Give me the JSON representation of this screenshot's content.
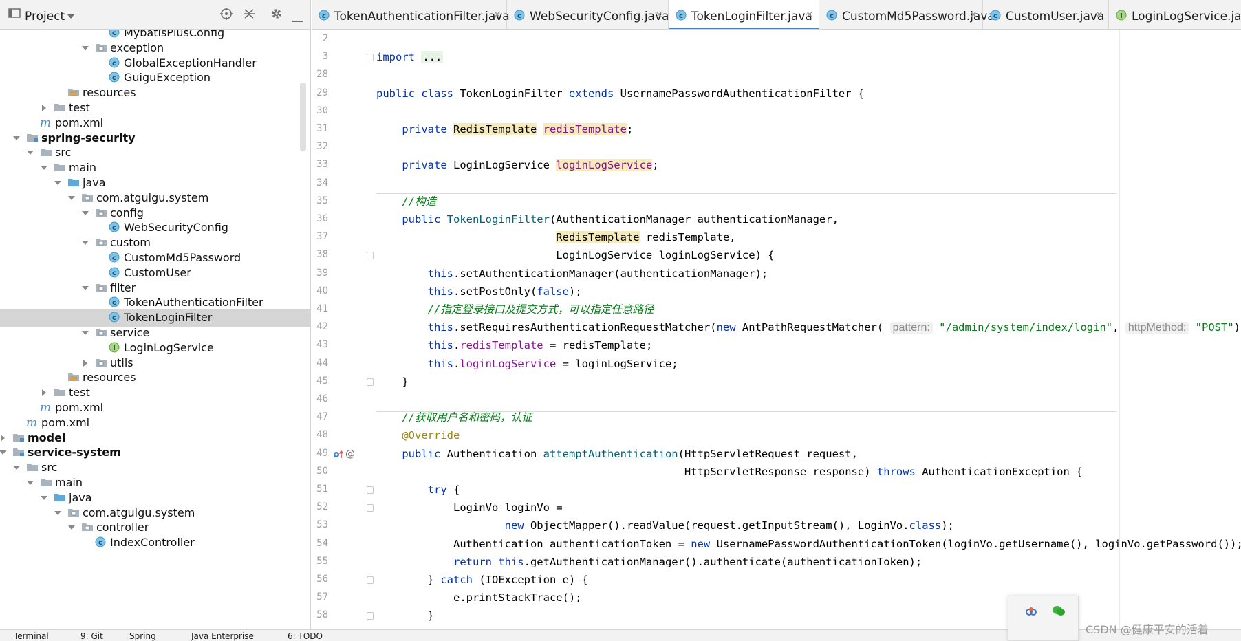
{
  "project": {
    "title": "Project",
    "tree": [
      {
        "label": "MybatisPlusConfig",
        "indent": 9,
        "kind": "class",
        "twisty": "none"
      },
      {
        "label": "exception",
        "indent": 8,
        "kind": "package",
        "twisty": "open"
      },
      {
        "label": "GlobalExceptionHandler",
        "indent": 9,
        "kind": "class",
        "twisty": "none"
      },
      {
        "label": "GuiguException",
        "indent": 9,
        "kind": "class",
        "twisty": "none"
      },
      {
        "label": "resources",
        "indent": 6,
        "kind": "resources",
        "twisty": "none"
      },
      {
        "label": "test",
        "indent": 5,
        "kind": "folder",
        "twisty": "closed"
      },
      {
        "label": "pom.xml",
        "indent": 4,
        "kind": "maven",
        "twisty": "none"
      },
      {
        "label": "spring-security",
        "indent": 3,
        "kind": "module",
        "twisty": "open",
        "bold": true
      },
      {
        "label": "src",
        "indent": 4,
        "kind": "folder",
        "twisty": "open"
      },
      {
        "label": "main",
        "indent": 5,
        "kind": "folder",
        "twisty": "open"
      },
      {
        "label": "java",
        "indent": 6,
        "kind": "source",
        "twisty": "open"
      },
      {
        "label": "com.atguigu.system",
        "indent": 7,
        "kind": "package",
        "twisty": "open"
      },
      {
        "label": "config",
        "indent": 8,
        "kind": "package",
        "twisty": "open"
      },
      {
        "label": "WebSecurityConfig",
        "indent": 9,
        "kind": "class",
        "twisty": "none"
      },
      {
        "label": "custom",
        "indent": 8,
        "kind": "package",
        "twisty": "open"
      },
      {
        "label": "CustomMd5Password",
        "indent": 9,
        "kind": "class",
        "twisty": "none"
      },
      {
        "label": "CustomUser",
        "indent": 9,
        "kind": "class",
        "twisty": "none"
      },
      {
        "label": "filter",
        "indent": 8,
        "kind": "package",
        "twisty": "open"
      },
      {
        "label": "TokenAuthenticationFilter",
        "indent": 9,
        "kind": "class",
        "twisty": "none"
      },
      {
        "label": "TokenLoginFilter",
        "indent": 9,
        "kind": "class",
        "twisty": "none",
        "selected": true
      },
      {
        "label": "service",
        "indent": 8,
        "kind": "package",
        "twisty": "open"
      },
      {
        "label": "LoginLogService",
        "indent": 9,
        "kind": "interface",
        "twisty": "none"
      },
      {
        "label": "utils",
        "indent": 8,
        "kind": "package",
        "twisty": "closed"
      },
      {
        "label": "resources",
        "indent": 6,
        "kind": "resources",
        "twisty": "none"
      },
      {
        "label": "test",
        "indent": 5,
        "kind": "folder",
        "twisty": "closed"
      },
      {
        "label": "pom.xml",
        "indent": 4,
        "kind": "maven",
        "twisty": "none"
      },
      {
        "label": "pom.xml",
        "indent": 3,
        "kind": "maven",
        "twisty": "none"
      },
      {
        "label": "model",
        "indent": 2,
        "kind": "module",
        "twisty": "closed",
        "bold": true
      },
      {
        "label": "service-system",
        "indent": 2,
        "kind": "module",
        "twisty": "open",
        "bold": true
      },
      {
        "label": "src",
        "indent": 3,
        "kind": "folder",
        "twisty": "open"
      },
      {
        "label": "main",
        "indent": 4,
        "kind": "folder",
        "twisty": "open"
      },
      {
        "label": "java",
        "indent": 5,
        "kind": "source",
        "twisty": "open"
      },
      {
        "label": "com.atguigu.system",
        "indent": 6,
        "kind": "package",
        "twisty": "open"
      },
      {
        "label": "controller",
        "indent": 7,
        "kind": "package",
        "twisty": "open"
      },
      {
        "label": "IndexController",
        "indent": 8,
        "kind": "class",
        "twisty": "none"
      }
    ]
  },
  "tabs": [
    {
      "label": "TokenAuthenticationFilter.java",
      "icon": "class-icon",
      "active": false
    },
    {
      "label": "WebSecurityConfig.java",
      "icon": "class-icon",
      "active": false
    },
    {
      "label": "TokenLoginFilter.java",
      "icon": "class-icon",
      "active": true
    },
    {
      "label": "CustomMd5Password.java",
      "icon": "class-icon",
      "active": false
    },
    {
      "label": "CustomUser.java",
      "icon": "class-icon",
      "active": false
    },
    {
      "label": "LoginLogService.java",
      "icon": "interface-icon",
      "active": false
    }
  ],
  "editor": {
    "line_numbers": [
      "2",
      "3",
      "28",
      "29",
      "30",
      "31",
      "32",
      "33",
      "34",
      "35",
      "36",
      "37",
      "38",
      "39",
      "40",
      "41",
      "42",
      "43",
      "44",
      "45",
      "46",
      "47",
      "48",
      "49",
      "50",
      "51",
      "52",
      "53",
      "54",
      "55",
      "56",
      "57",
      "58"
    ],
    "code": [
      [],
      [
        {
          "t": "import ",
          "c": "kw"
        },
        {
          "t": "...",
          "c": "fold-box"
        }
      ],
      [],
      [
        {
          "t": "public class ",
          "c": "kw"
        },
        {
          "t": "TokenLoginFilter "
        },
        {
          "t": "extends ",
          "c": "kw"
        },
        {
          "t": "UsernamePasswordAuthenticationFilter {"
        }
      ],
      [],
      [
        {
          "t": "    private ",
          "c": "kw"
        },
        {
          "t": "RedisTemplate",
          "c": "cls-hl"
        },
        {
          "t": " "
        },
        {
          "t": "redisTemplate",
          "c": "fld cls-hl"
        },
        {
          "t": ";"
        }
      ],
      [],
      [
        {
          "t": "    private ",
          "c": "kw"
        },
        {
          "t": "LoginLogService "
        },
        {
          "t": "loginLogService",
          "c": "fld cls-hl"
        },
        {
          "t": ";"
        }
      ],
      [],
      [
        {
          "t": "    //构造",
          "c": "cmg"
        }
      ],
      [
        {
          "t": "    public ",
          "c": "kw"
        },
        {
          "t": "TokenLoginFilter",
          "c": "def"
        },
        {
          "t": "(AuthenticationManager authenticationManager,"
        }
      ],
      [
        {
          "t": "                            "
        },
        {
          "t": "RedisTemplate",
          "c": "cls-hl"
        },
        {
          "t": " redisTemplate,"
        }
      ],
      [
        {
          "t": "                            LoginLogService loginLogService) {"
        }
      ],
      [
        {
          "t": "        this",
          "c": "kw"
        },
        {
          "t": ".setAuthenticationManager(authenticationManager);"
        }
      ],
      [
        {
          "t": "        this",
          "c": "kw"
        },
        {
          "t": ".setPostOnly("
        },
        {
          "t": "false",
          "c": "kw"
        },
        {
          "t": ");"
        }
      ],
      [
        {
          "t": "        //指定登录接口及提交方式，可以指定任意路径",
          "c": "cmg"
        }
      ],
      [
        {
          "t": "        this",
          "c": "kw"
        },
        {
          "t": ".setRequiresAuthenticationRequestMatcher("
        },
        {
          "t": "new ",
          "c": "kw"
        },
        {
          "t": "AntPathRequestMatcher( "
        },
        {
          "t": "pattern:",
          "c": "hint"
        },
        {
          "t": " "
        },
        {
          "t": "\"/admin/system/index/login\"",
          "c": "str"
        },
        {
          "t": ", "
        },
        {
          "t": "httpMethod:",
          "c": "hint"
        },
        {
          "t": " "
        },
        {
          "t": "\"POST\"",
          "c": "str"
        },
        {
          "t": "));"
        }
      ],
      [
        {
          "t": "        this",
          "c": "kw"
        },
        {
          "t": "."
        },
        {
          "t": "redisTemplate",
          "c": "fld"
        },
        {
          "t": " = redisTemplate;"
        }
      ],
      [
        {
          "t": "        this",
          "c": "kw"
        },
        {
          "t": "."
        },
        {
          "t": "loginLogService",
          "c": "fld"
        },
        {
          "t": " = loginLogService;"
        }
      ],
      [
        {
          "t": "    }"
        }
      ],
      [],
      [
        {
          "t": "    //获取用户名和密码，认证",
          "c": "cmg"
        }
      ],
      [
        {
          "t": "    @Override",
          "c": "ann"
        }
      ],
      [
        {
          "t": "    public ",
          "c": "kw"
        },
        {
          "t": "Authentication "
        },
        {
          "t": "attemptAuthentication",
          "c": "def"
        },
        {
          "t": "(HttpServletRequest request,"
        }
      ],
      [
        {
          "t": "                                                HttpServletResponse response) "
        },
        {
          "t": "throws ",
          "c": "kw"
        },
        {
          "t": "AuthenticationException {"
        }
      ],
      [
        {
          "t": "        try ",
          "c": "kw"
        },
        {
          "t": "{"
        }
      ],
      [
        {
          "t": "            LoginVo loginVo ="
        }
      ],
      [
        {
          "t": "                    new ",
          "c": "kw"
        },
        {
          "t": "ObjectMapper().readValue(request.getInputStream(), LoginVo."
        },
        {
          "t": "class",
          "c": "kw"
        },
        {
          "t": ");"
        }
      ],
      [
        {
          "t": "            Authentication authenticationToken = "
        },
        {
          "t": "new ",
          "c": "kw"
        },
        {
          "t": "UsernamePasswordAuthenticationToken(loginVo.getUsername(), loginVo.getPassword());"
        }
      ],
      [
        {
          "t": "            return this",
          "c": "kw"
        },
        {
          "t": ".getAuthenticationManager().authenticate(authenticationToken);"
        }
      ],
      [
        {
          "t": "        } "
        },
        {
          "t": "catch ",
          "c": "kw"
        },
        {
          "t": "(IOException e) {"
        }
      ],
      [
        {
          "t": "            e.printStackTrace();"
        }
      ],
      [
        {
          "t": "        }"
        }
      ]
    ]
  },
  "bottom_bar": {
    "items": [
      "Terminal",
      "9: Git",
      "Spring",
      "Java Enterprise",
      "6: TODO"
    ]
  },
  "watermark": "CSDN @健康平安的活着"
}
